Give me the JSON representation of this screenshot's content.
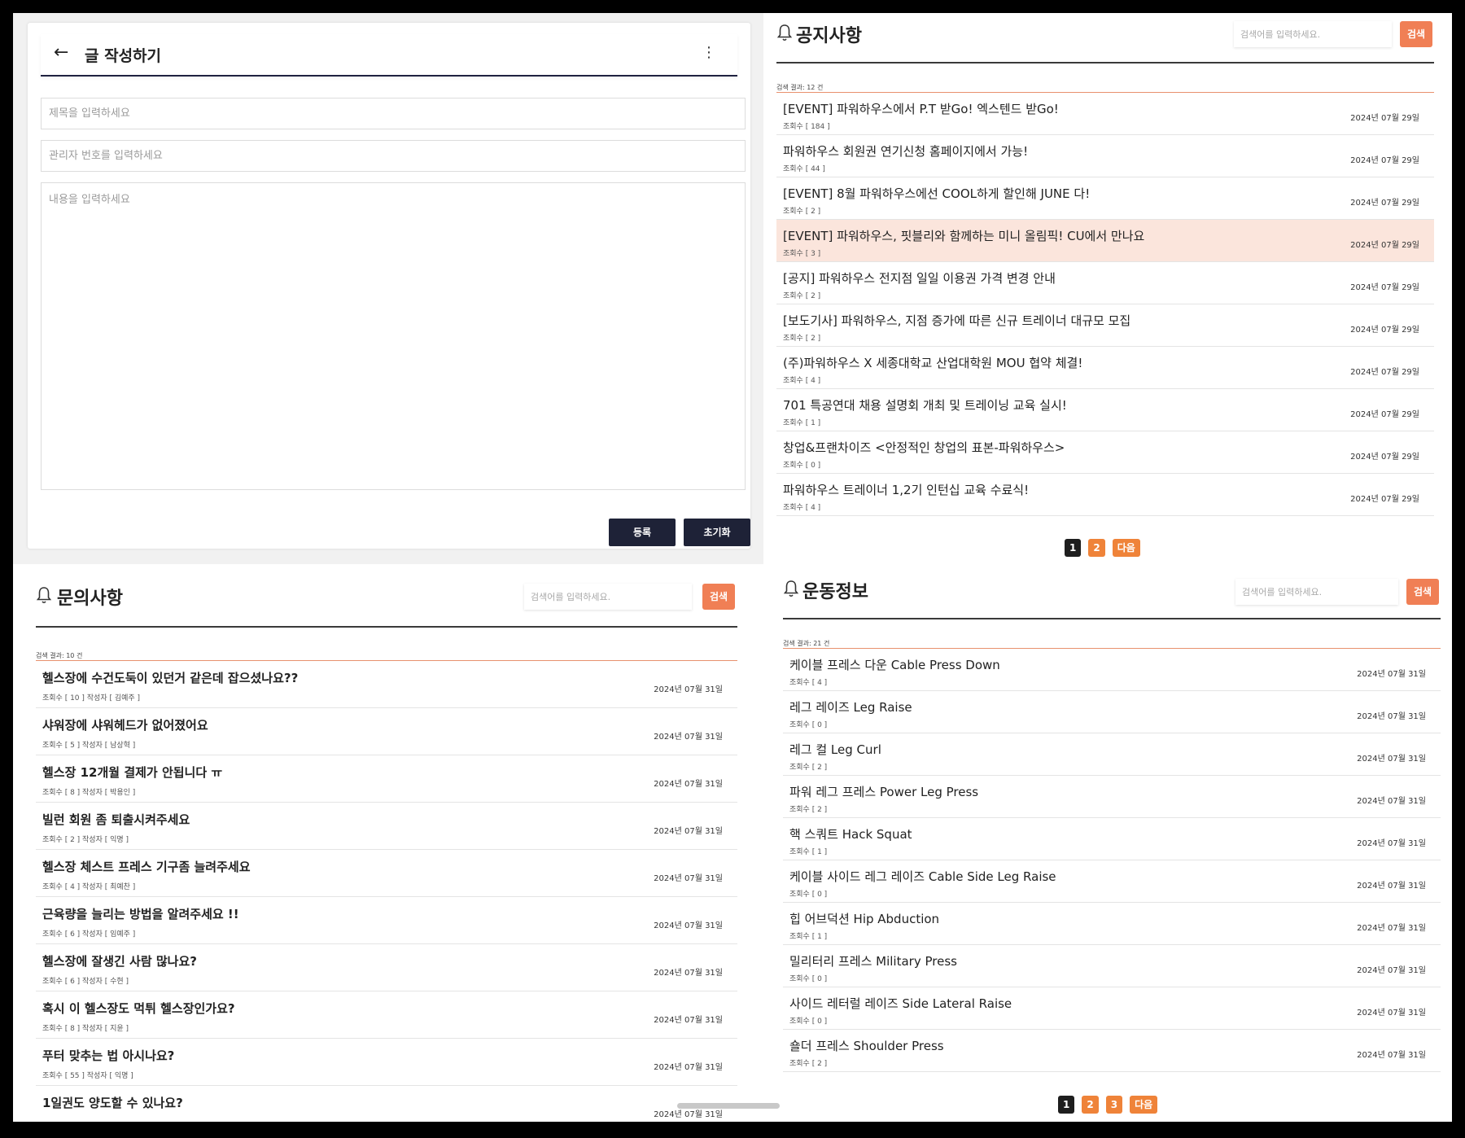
{
  "write": {
    "back_icon": "arrow-left-icon",
    "title": "글 작성하기",
    "menu_icon": "kebab-menu-icon",
    "title_placeholder": "제목을 입력하세요",
    "admin_placeholder": "관리자 번호를 입력하세요",
    "content_placeholder": "내용을 입력하세요",
    "submit_label": "등록",
    "reset_label": "초기화",
    "button_color": "#1e2237"
  },
  "notice": {
    "title": "공지사항",
    "icon": "bell-icon",
    "search_placeholder": "검색어를 입력하세요.",
    "search_label": "검색",
    "count_text": "검색 결과: 12 건",
    "items": [
      {
        "title": "[EVENT] 파워하우스에서 P.T 받Go! 엑스텐드 받Go!",
        "meta": "조회수 [ 184 ]",
        "date": "2024년 07월 29일"
      },
      {
        "title": "파워하우스 회원권 연기신청 홈페이지에서 가능!",
        "meta": "조회수 [ 44 ]",
        "date": "2024년 07월 29일"
      },
      {
        "title": "[EVENT] 8월 파워하우스에선 COOL하게 할인해 JUNE 다!",
        "meta": "조회수 [ 2 ]",
        "date": "2024년 07월 29일"
      },
      {
        "title": "[EVENT] 파워하우스, 핏블리와 함께하는 미니 올림픽! CU에서 만나요",
        "meta": "조회수 [ 3 ]",
        "date": "2024년 07월 29일",
        "highlighted": true
      },
      {
        "title": "[공지] 파워하우스 전지점 일일 이용권 가격 변경 안내",
        "meta": "조회수 [ 2 ]",
        "date": "2024년 07월 29일"
      },
      {
        "title": "[보도기사] 파워하우스, 지점 증가에 따른 신규 트레이너 대규모 모집",
        "meta": "조회수 [ 2 ]",
        "date": "2024년 07월 29일"
      },
      {
        "title": "(주)파워하우스 X 세종대학교 산업대학원 MOU 협약 체결!",
        "meta": "조회수 [ 4 ]",
        "date": "2024년 07월 29일"
      },
      {
        "title": "701 특공연대 채용 설명회 개최 및 트레이닝 교육 실시!",
        "meta": "조회수 [ 1 ]",
        "date": "2024년 07월 29일"
      },
      {
        "title": "창업&프랜차이즈 <안정적인 창업의 표본-파워하우스>",
        "meta": "조회수 [ 0 ]",
        "date": "2024년 07월 29일"
      },
      {
        "title": "파워하우스 트레이너 1,2기 인턴십 교육 수료식!",
        "meta": "조회수 [ 4 ]",
        "date": "2024년 07월 29일"
      }
    ],
    "pages": [
      "1",
      "2"
    ],
    "next_label": "다음"
  },
  "qna": {
    "title": "문의사항",
    "icon": "bell-icon",
    "search_placeholder": "검색어를 입력하세요.",
    "search_label": "검색",
    "count_text": "검색 결과: 10 건",
    "items": [
      {
        "title": "헬스장에 수건도둑이 있던거 같은데 잡으셨나요??",
        "meta": "조회수 [ 10 ] 작성자 [ 김예주 ]",
        "date": "2024년 07월 31일"
      },
      {
        "title": "샤워장에 샤워헤드가 없어졌어요",
        "meta": "조회수 [ 5 ] 작성자 [ 남상혁 ]",
        "date": "2024년 07월 31일"
      },
      {
        "title": "헬스장 12개월 결제가 안됩니다 ㅠ",
        "meta": "조회수 [ 8 ] 작성자 [ 박용인 ]",
        "date": "2024년 07월 31일"
      },
      {
        "title": "빌런 회원 좀 퇴출시켜주세요",
        "meta": "조회수 [ 2 ] 작성자 [ 익명 ]",
        "date": "2024년 07월 31일"
      },
      {
        "title": "헬스장 체스트 프레스 기구좀 늘려주세요",
        "meta": "조회수 [ 4 ] 작성자 [ 최예찬 ]",
        "date": "2024년 07월 31일"
      },
      {
        "title": "근육량을 늘리는 방법을 알려주세요 !!",
        "meta": "조회수 [ 6 ] 작성자 [ 임예주 ]",
        "date": "2024년 07월 31일"
      },
      {
        "title": "헬스장에 잘생긴 사람 많나요?",
        "meta": "조회수 [ 6 ] 작성자 [ 수현 ]",
        "date": "2024년 07월 31일"
      },
      {
        "title": "혹시 이 헬스장도 먹튀 헬스장인가요?",
        "meta": "조회수 [ 8 ] 작성자 [ 지윤 ]",
        "date": "2024년 07월 31일"
      },
      {
        "title": "푸터 맞추는 법 아시나요?",
        "meta": "조회수 [ 55 ] 작성자 [ 익명 ]",
        "date": "2024년 07월 31일"
      },
      {
        "title": "1일권도 양도할 수 있나요?",
        "meta": "",
        "date": "2024년 07월 31일"
      }
    ]
  },
  "exercise": {
    "title": "운동정보",
    "icon": "bell-icon",
    "search_placeholder": "검색어를 입력하세요.",
    "search_label": "검색",
    "count_text": "검색 결과: 21 건",
    "items": [
      {
        "title": "케이블 프레스 다운 Cable Press Down",
        "meta": "조회수 [ 4 ]",
        "date": "2024년 07월 31일"
      },
      {
        "title": "레그 레이즈 Leg Raise",
        "meta": "조회수 [ 0 ]",
        "date": "2024년 07월 31일"
      },
      {
        "title": "레그 컬 Leg Curl",
        "meta": "조회수 [ 2 ]",
        "date": "2024년 07월 31일"
      },
      {
        "title": "파워 레그 프레스 Power Leg Press",
        "meta": "조회수 [ 2 ]",
        "date": "2024년 07월 31일"
      },
      {
        "title": "핵 스쿼트 Hack Squat",
        "meta": "조회수 [ 1 ]",
        "date": "2024년 07월 31일"
      },
      {
        "title": "케이블 사이드 레그 레이즈 Cable Side Leg Raise",
        "meta": "조회수 [ 0 ]",
        "date": "2024년 07월 31일"
      },
      {
        "title": "힙 어브덕션 Hip Abduction",
        "meta": "조회수 [ 1 ]",
        "date": "2024년 07월 31일"
      },
      {
        "title": "밀리터리 프레스 Military Press",
        "meta": "조회수 [ 0 ]",
        "date": "2024년 07월 31일"
      },
      {
        "title": "사이드 레터럴 레이즈 Side Lateral Raise",
        "meta": "조회수 [ 0 ]",
        "date": "2024년 07월 31일"
      },
      {
        "title": "숄더 프레스 Shoulder Press",
        "meta": "조회수 [ 2 ]",
        "date": "2024년 07월 31일"
      }
    ],
    "pages": [
      "1",
      "2",
      "3"
    ],
    "next_label": "다음"
  },
  "colors": {
    "accent": "#f07f55",
    "pager_orange": "#ef8339",
    "pager_active": "#1e1e1e",
    "highlight_row": "#fbe5dc"
  }
}
